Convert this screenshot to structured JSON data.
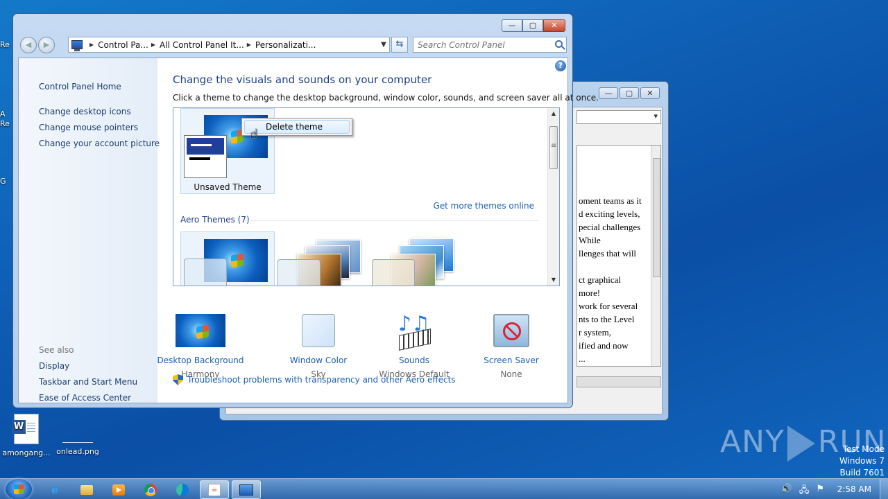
{
  "desktop": {
    "icons": [
      {
        "label": "amongang...",
        "kind": "word-document"
      },
      {
        "label": "onlead.png",
        "kind": "png-file"
      }
    ],
    "edge_fragments": [
      "Re",
      "A",
      "Re",
      "G"
    ],
    "watermark": "ANY RUN",
    "test_mode": {
      "line1": "Test Mode",
      "line2": "Windows 7",
      "line3": "Build 7601"
    }
  },
  "background_window": {
    "document_lines": [
      "oment teams as it",
      "d exciting levels,",
      "pecial challenges",
      "While",
      "llenges that will",
      "",
      "ct graphical",
      "more!",
      "work for several",
      "nts to the Level",
      "r system,",
      "ified and now",
      "..."
    ]
  },
  "window": {
    "breadcrumbs": [
      "Control Pa...",
      "All Control Panel It...",
      "Personalizati..."
    ],
    "search_placeholder": "Search Control Panel",
    "caption": {
      "minimize": "—",
      "maximize": "▢",
      "close": "✕"
    }
  },
  "left_pane": {
    "home": "Control Panel Home",
    "links": [
      "Change desktop icons",
      "Change mouse pointers",
      "Change your account picture"
    ],
    "see_also_heading": "See also",
    "see_also": [
      "Display",
      "Taskbar and Start Menu",
      "Ease of Access Center"
    ]
  },
  "main": {
    "title": "Change the visuals and sounds on your computer",
    "subtitle": "Click a theme to change the desktop background, window color, sounds, and screen saver all at once.",
    "unsaved_theme_label": "Unsaved Theme",
    "get_more_link": "Get more themes online",
    "aero_group_heading": "Aero Themes (7)",
    "context_menu": {
      "items": [
        "Delete theme"
      ]
    },
    "bottom_items": [
      {
        "label": "Desktop Background",
        "value": "Harmony",
        "icon": "desktop-background-icon"
      },
      {
        "label": "Window Color",
        "value": "Sky",
        "icon": "window-color-icon"
      },
      {
        "label": "Sounds",
        "value": "Windows Default",
        "icon": "sounds-icon"
      },
      {
        "label": "Screen Saver",
        "value": "None",
        "icon": "screen-saver-icon"
      }
    ],
    "troubleshoot_link": "Troubleshoot problems with transparency and other Aero effects"
  },
  "taskbar": {
    "clock": "2:58 AM",
    "pinned": [
      "internet-explorer-icon",
      "windows-explorer-icon",
      "media-player-icon",
      "chrome-icon",
      "edge-icon",
      "java-icon",
      "control-panel-icon"
    ]
  }
}
